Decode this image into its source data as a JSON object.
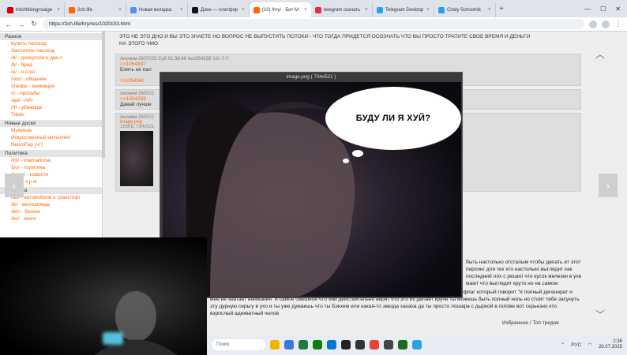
{
  "tabs": [
    {
      "label": "hitchhikingnsaige",
      "color": "#cc0000"
    },
    {
      "label": "2ch.life",
      "color": "#ff6600"
    },
    {
      "label": "Новая вкладка",
      "color": "#5b8def"
    },
    {
      "label": "Дзен — платфор",
      "color": "#111111"
    },
    {
      "label": "(10) /hry/ - Бит М",
      "color": "#ff6600",
      "active": true
    },
    {
      "label": "telegram скачать",
      "color": "#e03030"
    },
    {
      "label": "Telegram Desktop",
      "color": "#2aa3e0"
    },
    {
      "label": "Cindy Schoolnik",
      "color": "#2aa3e0"
    }
  ],
  "address": {
    "url": "https://2ch.life/hry/res/1020103.html"
  },
  "sidebar": {
    "sections": [
      {
        "title": "Разное",
        "items": [
          "Купить пасскод",
          "Заплатить пасскод",
          "/d/ - дискуссии о два.ч",
          "/b/ - бред",
          "/o/ - o:o:ян",
          "/soc/ - общение",
          "/media/ - анимация",
          "/r/ - просьбы",
          "/api/ - API",
          "/rf/ - убежище",
          "Тикач"
        ]
      },
      {
        "title": "Новые доски",
        "items": [
          "Мужикан",
          "Искусственный интеллект",
          "NeuroFap (чт)"
        ]
      },
      {
        "title": "Политика",
        "items": [
          "/int/ - international",
          "/po/ - политика",
          "/news/ - новости",
          "/hry/ - х р ю"
        ]
      },
      {
        "title": "Тематика",
        "items": [
          "/au/ - автомобили и транспорт",
          "/bi/ - велосипеды",
          "/biz/ - бизнес",
          "/bo/ - книги"
        ]
      }
    ]
  },
  "op": {
    "text_line1": "ЭТО НЕ ЭТО ДНО И ВЫ ЭТО ЗНАЕТЕ НО ВОПРОС НЕ ВЫПУСТИТЬ ПОТОКИ - ЧТО ТОГДА ПРИДЕТСЯ ОСОЗНАТЬ ЧТО ВЫ ПРОСТО ТРАТИТЕ СВОЕ ВРЕМЯ И ДЕНЬГИ",
    "text_line2": "НА ЭТОГО ЧМО"
  },
  "posts": [
    {
      "meta": "Аноним 26/07/25 Суб 01:38:49 №1054339",
      "counts": "181  0  0",
      "ref": ">>1054337",
      "text": "Блять не пал",
      "reply": ">>1054340"
    },
    {
      "meta": "Аноним 26/07/2",
      "ref": ">>1054339",
      "text": "Давай лучше"
    },
    {
      "meta": "Аноним 26/07/2",
      "file": "image.png",
      "file_size": "163Кб, 734x521"
    }
  ],
  "viewer": {
    "title": "image.png ( 734x521 )",
    "caption": "БУДУ ЛИ Я ХУЙ?"
  },
  "bottom_text": "деле выглядят как подростки которые не переросли период бунта против родителей серга в ухе это как флаг который говорит \"я полный дегенерат и мне не хватает внимания\" и самое смешное что они действительно верят что это их делает круче ты можешь быть полный ноль но стоит тебе засунуть эту дурную серьгу в ухо и ты уже думаешь что ты Бэкхем или какая-то звезда хахаха да ты просто лошара с дыркой в голове вот серьезно кто взрослый адекватный челов",
  "right_text": "быть настолько отсталым чтобы делать ит этот пирсинг для тех кто настолько выглядит как последний лох с решил что кусок железки в ухе мают что выглядят круто но на самом",
  "favorites": "Избранное / Топ тредов",
  "taskbar": {
    "search": "Поиск",
    "lang": "РУС",
    "time": "2:36",
    "date": "28.07.2025"
  }
}
